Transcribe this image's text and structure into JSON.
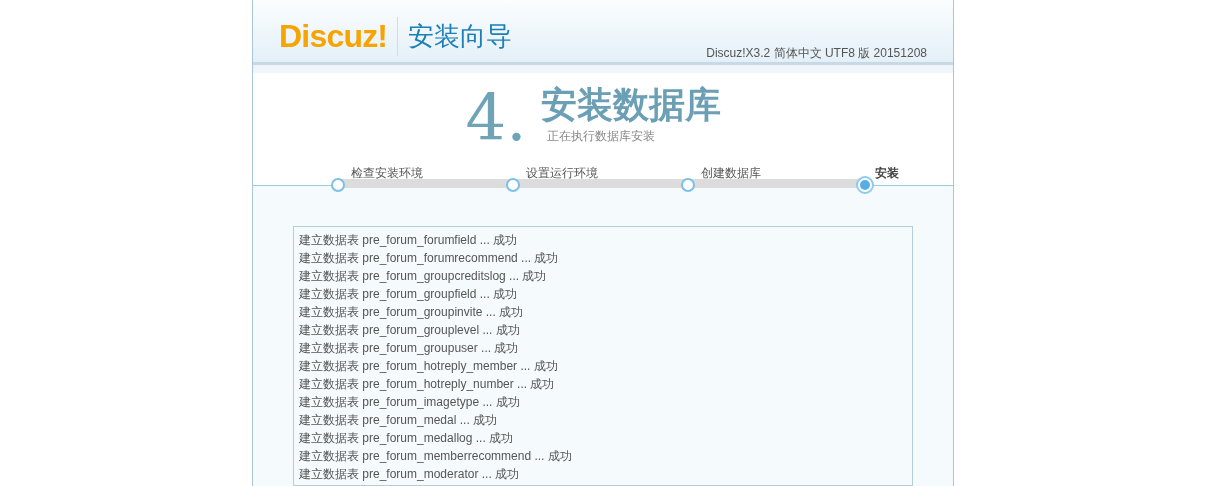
{
  "header": {
    "logo": "Discuz!",
    "title": "安装向导",
    "version": "Discuz!X3.2 简体中文 UTF8 版 20151208"
  },
  "step_title": {
    "number": "4.",
    "title": "安装数据库",
    "subtitle": "正在执行数据库安装"
  },
  "steps": [
    {
      "label": "检查安装环境",
      "selected": false
    },
    {
      "label": "设置运行环境",
      "selected": false
    },
    {
      "label": "创建数据库",
      "selected": false
    },
    {
      "label": "安装",
      "selected": true
    }
  ],
  "log": [
    "建立数据表 pre_forum_forumfield ... 成功",
    "建立数据表 pre_forum_forumrecommend ... 成功",
    "建立数据表 pre_forum_groupcreditslog ... 成功",
    "建立数据表 pre_forum_groupfield ... 成功",
    "建立数据表 pre_forum_groupinvite ... 成功",
    "建立数据表 pre_forum_grouplevel ... 成功",
    "建立数据表 pre_forum_groupuser ... 成功",
    "建立数据表 pre_forum_hotreply_member ... 成功",
    "建立数据表 pre_forum_hotreply_number ... 成功",
    "建立数据表 pre_forum_imagetype ... 成功",
    "建立数据表 pre_forum_medal ... 成功",
    "建立数据表 pre_forum_medallog ... 成功",
    "建立数据表 pre_forum_memberrecommend ... 成功",
    "建立数据表 pre_forum_moderator ... 成功"
  ]
}
